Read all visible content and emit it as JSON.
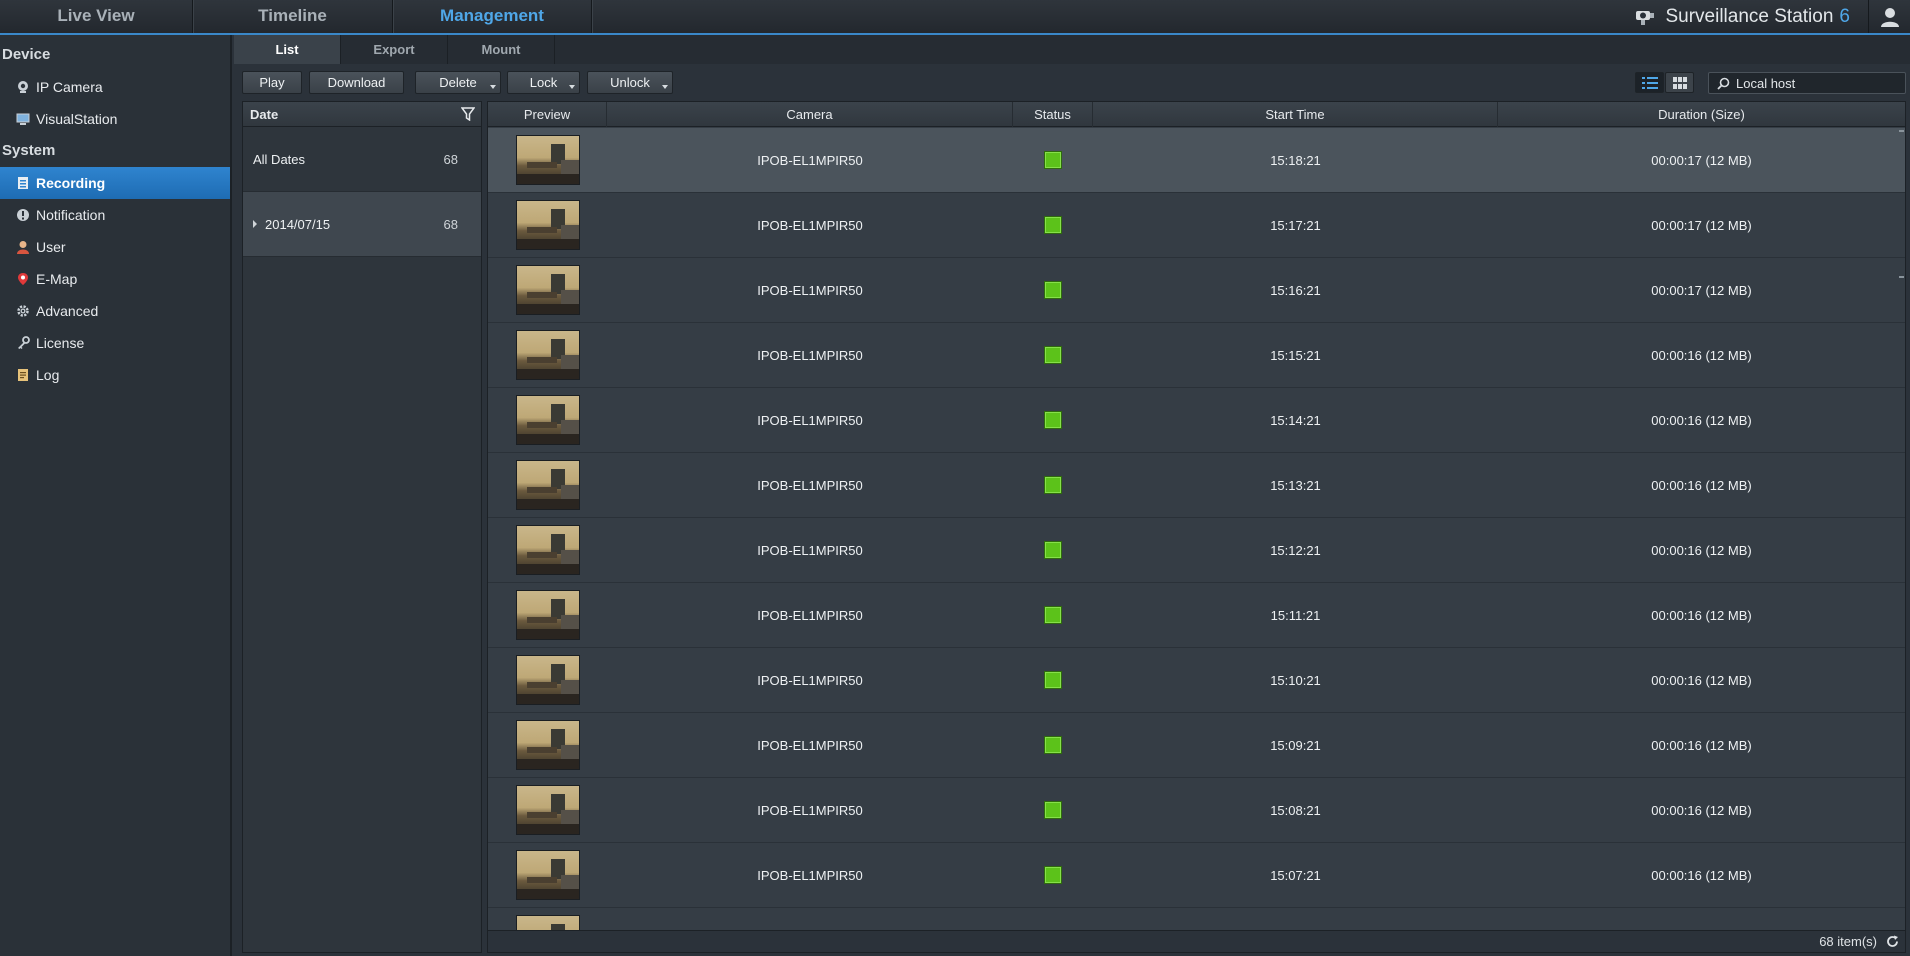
{
  "topnav": {
    "tabs": [
      {
        "label": "Live View",
        "active": false
      },
      {
        "label": "Timeline",
        "active": false
      },
      {
        "label": "Management",
        "active": true
      }
    ],
    "brand": "Surveillance Station",
    "brand_version": "6"
  },
  "sidebar": {
    "sections": [
      {
        "title": "Device",
        "items": [
          {
            "label": "IP Camera",
            "icon": "ip-camera-icon",
            "active": false
          },
          {
            "label": "VisualStation",
            "icon": "visualstation-icon",
            "active": false
          }
        ]
      },
      {
        "title": "System",
        "items": [
          {
            "label": "Recording",
            "icon": "recording-icon",
            "active": true
          },
          {
            "label": "Notification",
            "icon": "notification-icon",
            "active": false
          },
          {
            "label": "User",
            "icon": "user-icon",
            "active": false
          },
          {
            "label": "E-Map",
            "icon": "emap-icon",
            "active": false
          },
          {
            "label": "Advanced",
            "icon": "gear-icon",
            "active": false
          },
          {
            "label": "License",
            "icon": "key-icon",
            "active": false
          },
          {
            "label": "Log",
            "icon": "log-icon",
            "active": false
          }
        ]
      }
    ]
  },
  "subtabs": [
    {
      "label": "List",
      "active": true
    },
    {
      "label": "Export",
      "active": false
    },
    {
      "label": "Mount",
      "active": false
    }
  ],
  "toolbar": {
    "play": "Play",
    "download": "Download",
    "delete": "Delete",
    "lock": "Lock",
    "unlock": "Unlock",
    "search_placeholder": "Local host"
  },
  "date_panel": {
    "header": "Date",
    "rows": [
      {
        "label": "All Dates",
        "count": "68",
        "expandable": false,
        "selected": false
      },
      {
        "label": "2014/07/15",
        "count": "68",
        "expandable": true,
        "selected": true
      }
    ]
  },
  "grid": {
    "columns": [
      "Preview",
      "Camera",
      "Status",
      "Start Time",
      "Duration (Size)"
    ],
    "rows": [
      {
        "camera": "IPOB-EL1MPIR50",
        "start": "15:18:21",
        "duration": "00:00:17 (12 MB)",
        "selected": true
      },
      {
        "camera": "IPOB-EL1MPIR50",
        "start": "15:17:21",
        "duration": "00:00:17 (12 MB)"
      },
      {
        "camera": "IPOB-EL1MPIR50",
        "start": "15:16:21",
        "duration": "00:00:17 (12 MB)"
      },
      {
        "camera": "IPOB-EL1MPIR50",
        "start": "15:15:21",
        "duration": "00:00:16 (12 MB)"
      },
      {
        "camera": "IPOB-EL1MPIR50",
        "start": "15:14:21",
        "duration": "00:00:16 (12 MB)"
      },
      {
        "camera": "IPOB-EL1MPIR50",
        "start": "15:13:21",
        "duration": "00:00:16 (12 MB)"
      },
      {
        "camera": "IPOB-EL1MPIR50",
        "start": "15:12:21",
        "duration": "00:00:16 (12 MB)"
      },
      {
        "camera": "IPOB-EL1MPIR50",
        "start": "15:11:21",
        "duration": "00:00:16 (12 MB)"
      },
      {
        "camera": "IPOB-EL1MPIR50",
        "start": "15:10:21",
        "duration": "00:00:16 (12 MB)"
      },
      {
        "camera": "IPOB-EL1MPIR50",
        "start": "15:09:21",
        "duration": "00:00:16 (12 MB)"
      },
      {
        "camera": "IPOB-EL1MPIR50",
        "start": "15:08:21",
        "duration": "00:00:16 (12 MB)"
      },
      {
        "camera": "IPOB-EL1MPIR50",
        "start": "15:07:21",
        "duration": "00:00:16 (12 MB)"
      },
      {
        "camera": "",
        "start": "",
        "duration": "",
        "partial": true
      }
    ],
    "status_color": "#5cc21a",
    "footer_count": "68 item(s)"
  },
  "colors": {
    "accent": "#4fa7e8",
    "active_item": "#2f84cf",
    "background": "#2b323a"
  }
}
